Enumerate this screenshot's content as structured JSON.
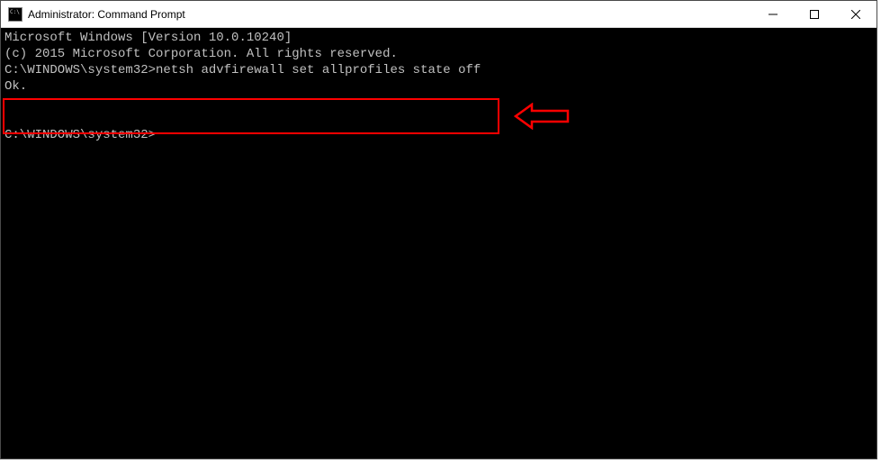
{
  "window": {
    "title": "Administrator: Command Prompt"
  },
  "terminal": {
    "line1": "Microsoft Windows [Version 10.0.10240]",
    "line2": "(c) 2015 Microsoft Corporation. All rights reserved.",
    "blank": "",
    "prompt1_prefix": "C:\\WINDOWS\\system32>",
    "prompt1_command": "netsh advfirewall set allprofiles state off",
    "response": "Ok.",
    "prompt2_prefix": "C:\\WINDOWS\\system32>",
    "prompt2_command": ""
  },
  "annotation": {
    "highlight_color": "#ff0000",
    "arrow_semantic": "left-arrow-pointing-to-command"
  }
}
